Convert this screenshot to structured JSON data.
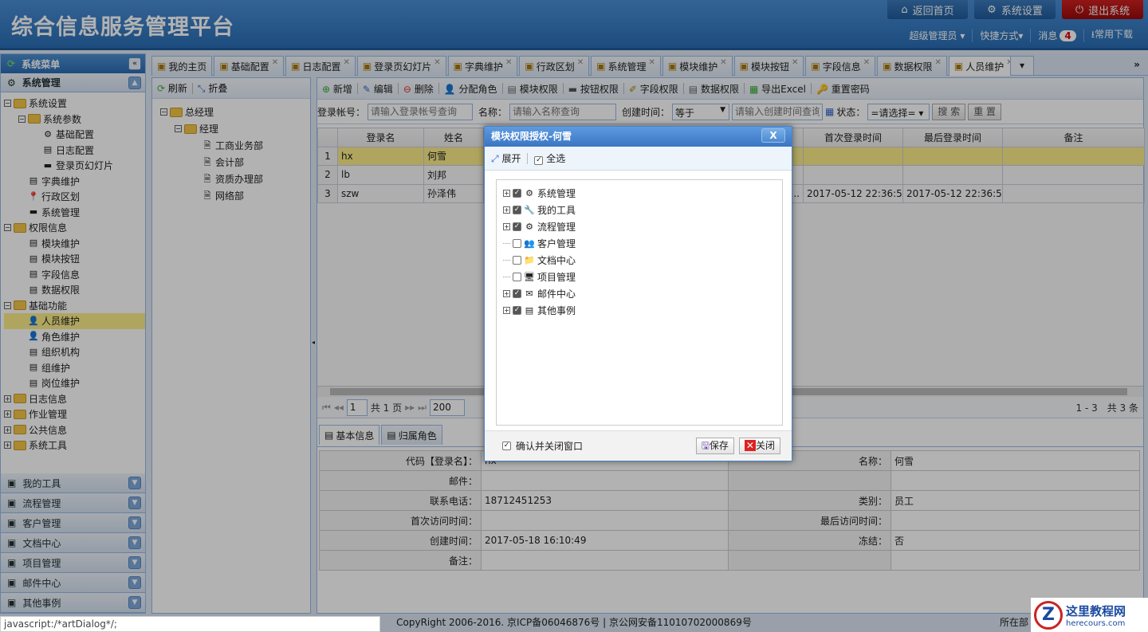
{
  "header": {
    "title": "综合信息服务管理平台",
    "buttons": [
      "返回首页",
      "系统设置",
      "退出系统"
    ],
    "user": "超级管理员",
    "shortcuts": "快捷方式",
    "messages": "消息",
    "message_count": "4",
    "downloads": "常用下载"
  },
  "sidebar": {
    "title": "系统菜单",
    "section": "系统管理",
    "tree": [
      {
        "label": "系统设置",
        "level": 0,
        "type": "folder"
      },
      {
        "label": "系统参数",
        "level": 1,
        "type": "folder"
      },
      {
        "label": "基础配置",
        "level": 2,
        "type": "gear"
      },
      {
        "label": "日志配置",
        "level": 2,
        "type": "doc"
      },
      {
        "label": "登录页幻灯片",
        "level": 2,
        "type": "img"
      },
      {
        "label": "字典维护",
        "level": 1,
        "type": "doc"
      },
      {
        "label": "行政区划",
        "level": 1,
        "type": "pin"
      },
      {
        "label": "系统管理",
        "level": 1,
        "type": "img"
      },
      {
        "label": "权限信息",
        "level": 0,
        "type": "folder"
      },
      {
        "label": "模块维护",
        "level": 1,
        "type": "doc"
      },
      {
        "label": "模块按钮",
        "level": 1,
        "type": "doc"
      },
      {
        "label": "字段信息",
        "level": 1,
        "type": "doc"
      },
      {
        "label": "数据权限",
        "level": 1,
        "type": "doc"
      },
      {
        "label": "基础功能",
        "level": 0,
        "type": "folder"
      },
      {
        "label": "人员维护",
        "level": 1,
        "type": "user",
        "selected": true
      },
      {
        "label": "角色维护",
        "level": 1,
        "type": "user"
      },
      {
        "label": "组织机构",
        "level": 1,
        "type": "doc"
      },
      {
        "label": "组维护",
        "level": 1,
        "type": "doc"
      },
      {
        "label": "岗位维护",
        "level": 1,
        "type": "doc"
      },
      {
        "label": "日志信息",
        "level": 0,
        "type": "folder-closed"
      },
      {
        "label": "作业管理",
        "level": 0,
        "type": "folder-closed"
      },
      {
        "label": "公共信息",
        "level": 0,
        "type": "folder-closed"
      },
      {
        "label": "系统工具",
        "level": 0,
        "type": "folder-closed"
      }
    ],
    "accordions": [
      "我的工具",
      "流程管理",
      "客户管理",
      "文档中心",
      "项目管理",
      "邮件中心",
      "其他事例"
    ]
  },
  "tabs": [
    "我的主页",
    "基础配置",
    "日志配置",
    "登录页幻灯片",
    "字典维护",
    "行政区划",
    "系统管理",
    "模块维护",
    "模块按钮",
    "字段信息",
    "数据权限",
    "人员维护"
  ],
  "org": {
    "refresh": "刷新",
    "collapse": "折叠",
    "tree": [
      {
        "label": "总经理",
        "level": 0
      },
      {
        "label": "经理",
        "level": 1
      },
      {
        "label": "工商业务部",
        "level": 2
      },
      {
        "label": "会计部",
        "level": 2
      },
      {
        "label": "资质办理部",
        "level": 2
      },
      {
        "label": "网络部",
        "level": 2
      }
    ]
  },
  "toolbar": [
    "新增",
    "编辑",
    "删除",
    "分配角色",
    "模块权限",
    "按钮权限",
    "字段权限",
    "数据权限",
    "导出Excel",
    "重置密码"
  ],
  "search": {
    "account_label": "登录帐号：",
    "account_placeholder": "请输入登录帐号查询",
    "name_label": "名称：",
    "name_placeholder": "请输入名称查询",
    "time_label": "创建时间：",
    "time_op": "等于",
    "time_placeholder": "请输入创建时间查询",
    "status_label": "状态：",
    "status_value": "=请选择=",
    "search": "搜 索",
    "reset": "重 置"
  },
  "grid": {
    "columns": [
      "",
      "登录名",
      "姓名",
      "",
      "",
      "",
      "首次登录时间",
      "最后登录时间",
      "备注"
    ],
    "rows": [
      [
        "1",
        "hx",
        "何雪",
        "",
        "",
        "",
        "",
        "",
        ""
      ],
      [
        "2",
        "lb",
        "刘邦",
        "",
        "",
        "",
        "",
        "",
        ""
      ],
      [
        "3",
        "szw",
        "孙泽伟",
        "",
        "",
        "...",
        "2017-05-12 22:36:52",
        "2017-05-12 22:36:52",
        ""
      ]
    ]
  },
  "pager": {
    "page": "1",
    "total_pages": "共 1 页",
    "page_size": "200",
    "summary": "1 - 3　共 3 条"
  },
  "detail": {
    "tabs": [
      "基本信息",
      "归属角色"
    ],
    "rows": [
      [
        "代码【登录名】：",
        "hx",
        "名称：",
        "何雪"
      ],
      [
        "邮件：",
        "",
        "",
        ""
      ],
      [
        "联系电话：",
        "18712451253",
        "类别：",
        "员工"
      ],
      [
        "首次访问时间：",
        "",
        "最后访问时间：",
        ""
      ],
      [
        "创建时间：",
        "2017-05-18 16:10:49",
        "冻结：",
        "否"
      ],
      [
        "备注：",
        "",
        "",
        ""
      ]
    ]
  },
  "dialog": {
    "title": "模块权限授权-何雪",
    "close": "X",
    "expand": "展开",
    "select_all": "全选",
    "tree": [
      {
        "label": "系统管理",
        "checked": true,
        "expandable": true,
        "icon": "⚙"
      },
      {
        "label": "我的工具",
        "checked": true,
        "expandable": true,
        "icon": "🔧"
      },
      {
        "label": "流程管理",
        "checked": true,
        "expandable": true,
        "icon": "⚙"
      },
      {
        "label": "客户管理",
        "checked": false,
        "expandable": false,
        "icon": "👥"
      },
      {
        "label": "文档中心",
        "checked": false,
        "expandable": false,
        "icon": "📁"
      },
      {
        "label": "项目管理",
        "checked": false,
        "expandable": false,
        "icon": "🖥"
      },
      {
        "label": "邮件中心",
        "checked": true,
        "expandable": true,
        "icon": "✉"
      },
      {
        "label": "其他事例",
        "checked": true,
        "expandable": true,
        "icon": "▤"
      }
    ],
    "confirm_close": "确认并关闭窗口",
    "save": "保存",
    "close_btn": "关闭"
  },
  "footer": {
    "copyright": "CopyRight 2006-2016. 京ICP备06046876号 | 京公网安备11010702000869号",
    "dept": "所在部",
    "status_url": "javascript:/*artDialog*/;"
  },
  "watermark": {
    "name": "这里教程网",
    "url": "herecours.com"
  }
}
